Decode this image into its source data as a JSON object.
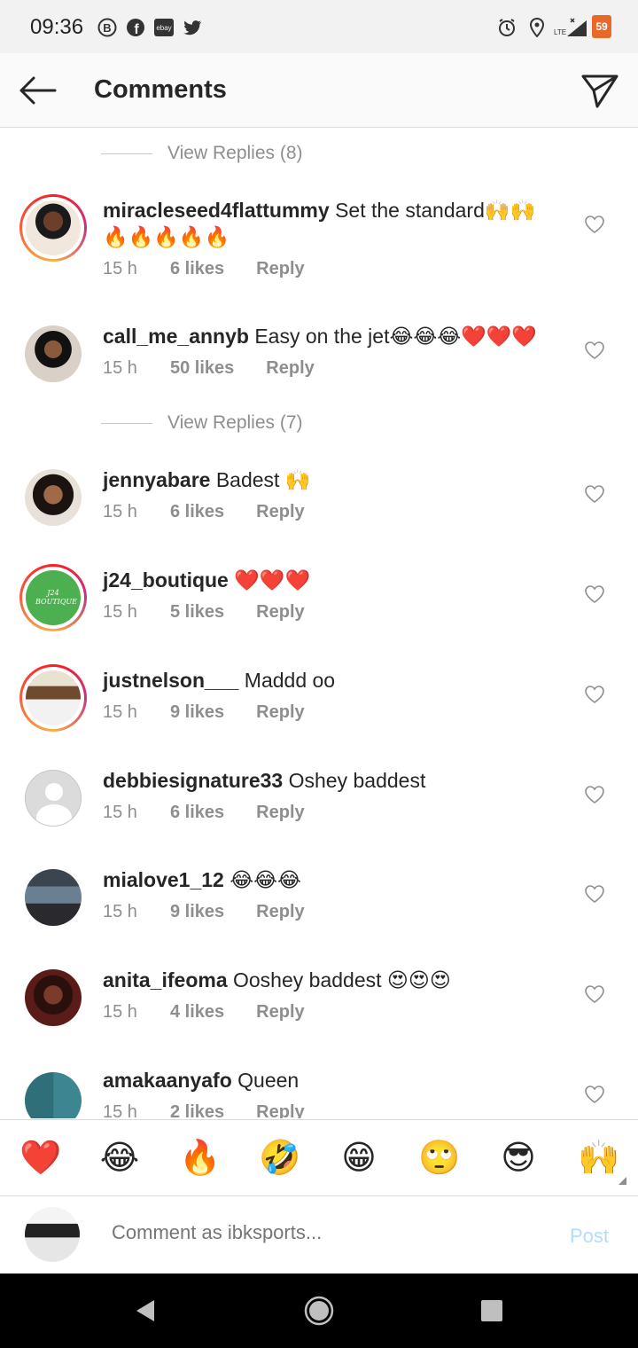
{
  "status_bar": {
    "time": "09:36",
    "battery": "59",
    "network": "LTE"
  },
  "header": {
    "title": "Comments",
    "back_icon": "arrow-left-icon",
    "share_icon": "paper-plane-icon"
  },
  "view_replies": [
    {
      "label": "View Replies (8)"
    },
    {
      "label": "View Replies (7)"
    }
  ],
  "comments": [
    {
      "user": "miracleseed4flattummy",
      "text": "Set the standard🙌🙌",
      "text2": "🔥🔥🔥🔥🔥",
      "time": "15 h",
      "likes": "6 likes",
      "reply": "Reply",
      "ring": true
    },
    {
      "user": "call_me_annyb",
      "text": "Easy on the jet😂😂😂❤️❤️❤️",
      "time": "15 h",
      "likes": "50 likes",
      "reply": "Reply",
      "ring": false
    },
    {
      "user": "jennyabare",
      "text": "Badest 🙌",
      "time": "15 h",
      "likes": "6 likes",
      "reply": "Reply",
      "ring": false
    },
    {
      "user": "j24_boutique",
      "text": "❤️❤️❤️",
      "time": "15 h",
      "likes": "5 likes",
      "reply": "Reply",
      "ring": true,
      "avatar_text": "J24 BOUTIQUE"
    },
    {
      "user": "justnelson___",
      "text": "Maddd oo",
      "time": "15 h",
      "likes": "9 likes",
      "reply": "Reply",
      "ring": true
    },
    {
      "user": "debbiesignature33",
      "text": "Oshey baddest",
      "time": "15 h",
      "likes": "6 likes",
      "reply": "Reply",
      "ring": false
    },
    {
      "user": "mialove1_12",
      "text": "😂😂😂",
      "time": "15 h",
      "likes": "9 likes",
      "reply": "Reply",
      "ring": false
    },
    {
      "user": "anita_ifeoma",
      "text": "Ooshey baddest 😍😍😍",
      "time": "15 h",
      "likes": "4 likes",
      "reply": "Reply",
      "ring": false
    },
    {
      "user": "amakaanyafo",
      "text": "Queen",
      "time": "15 h",
      "likes": "2 likes",
      "reply": "Reply",
      "ring": false
    }
  ],
  "emoji_bar": [
    "❤️",
    "😂",
    "🔥",
    "🤣",
    "😁",
    "🙄",
    "😎",
    "🙌"
  ],
  "composer": {
    "placeholder": "Comment as ibksports...",
    "post_label": "Post"
  },
  "colors": {
    "accent": "#0095f6",
    "post_disabled": "#b3dbff",
    "muted": "#8e8e8e",
    "text": "#262626"
  }
}
